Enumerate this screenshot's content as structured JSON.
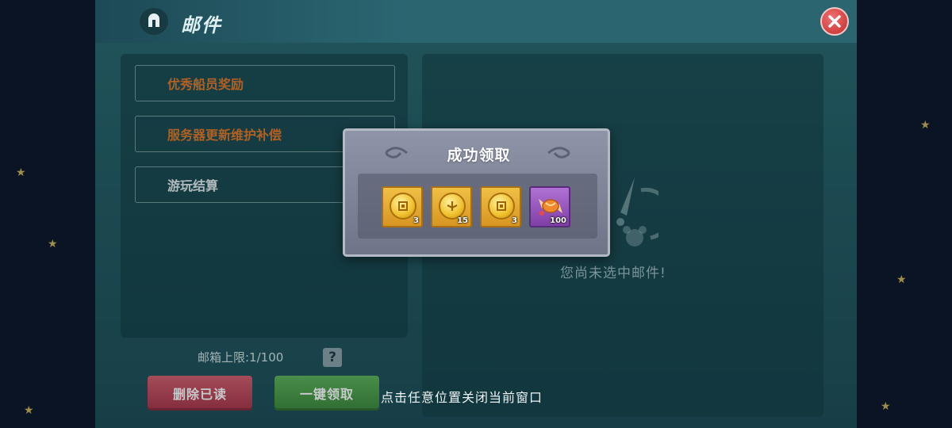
{
  "window": {
    "title": "邮件"
  },
  "mail_list": [
    {
      "label": "优秀船员奖励",
      "color": "#e07a2a"
    },
    {
      "label": "服务器更新维护补偿",
      "color": "#e07a2a"
    },
    {
      "label": "游玩结算",
      "color": "#e3eeee"
    }
  ],
  "detail": {
    "empty_text": "您尚未选中邮件!"
  },
  "footer": {
    "capacity_text": "邮箱上限:1/100",
    "help_label": "?",
    "delete_read_label": "删除已读",
    "claim_all_label": "一键领取",
    "close_hint": "点击任意位置关闭当前窗口"
  },
  "popup": {
    "title": "成功领取",
    "rewards": [
      {
        "icon": "gold-coin-icon",
        "quantity": "3"
      },
      {
        "icon": "gold-coin-leaf-icon",
        "quantity": "15"
      },
      {
        "icon": "gold-coin-icon",
        "quantity": "3"
      },
      {
        "icon": "candy-icon",
        "quantity": "100"
      }
    ]
  },
  "colors": {
    "accent_orange": "#e07a2a",
    "panel_teal": "#2b6a70",
    "close_red": "#d23c3c"
  }
}
